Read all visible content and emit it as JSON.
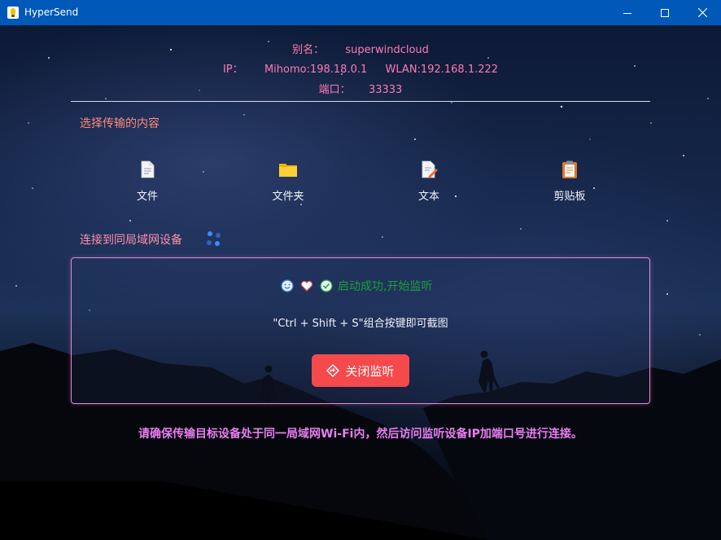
{
  "window": {
    "title": "HyperSend",
    "minimize_icon": "minimize-icon",
    "maximize_icon": "maximize-icon",
    "close_icon": "close-icon",
    "titlebar_color": "#0058b8"
  },
  "info": {
    "alias_label": "别名：",
    "alias_value": "superwindcloud",
    "ip_label": "IP：",
    "ip_mihomo": "Mihomo:198.18.0.1",
    "ip_wlan": "WLAN:192.168.1.222",
    "port_label": "端口：",
    "port_value": "33333",
    "text_color": "#ff7bb0"
  },
  "select_section": {
    "title": "选择传输的内容",
    "options": [
      {
        "label": "文件",
        "icon": "file-icon"
      },
      {
        "label": "文件夹",
        "icon": "folder-icon"
      },
      {
        "label": "文本",
        "icon": "text-edit-icon"
      },
      {
        "label": "剪贴板",
        "icon": "clipboard-icon"
      }
    ]
  },
  "lan_section": {
    "title": "连接到同局域网设备",
    "loading_icon": "loading-dots-icon"
  },
  "listen_panel": {
    "status_icons": [
      "smile-icon",
      "heart-icon",
      "check-circle-icon"
    ],
    "status_text": "启动成功,开始监听",
    "hint": "\"Ctrl + Shift + S\"组合按键即可截图",
    "stop_button": "关闭监听",
    "stop_button_icon": "diamond-arrow-icon",
    "stop_button_color": "#f5494c",
    "status_color": "#1e9e3a"
  },
  "footer": {
    "note": "请确保传输目标设备处于同一局域网Wi-Fi内，然后访问监听设备IP加端口号进行连接。"
  }
}
